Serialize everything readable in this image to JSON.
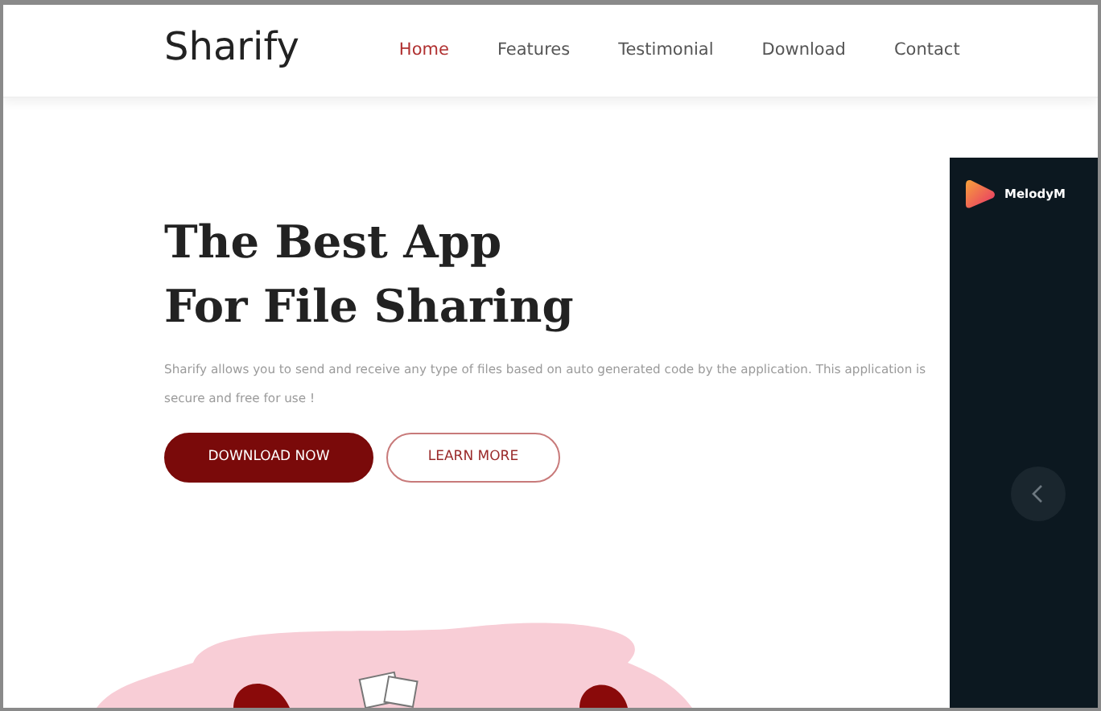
{
  "brand": "Sharify",
  "nav": [
    {
      "label": "Home",
      "selected": true
    },
    {
      "label": "Features",
      "selected": false
    },
    {
      "label": "Testimonial",
      "selected": false
    },
    {
      "label": "Download",
      "selected": false
    },
    {
      "label": "Contact",
      "selected": false
    }
  ],
  "hero": {
    "title_lines": [
      "The Best App",
      "For File Sharing"
    ],
    "description": "Sharify allows you to send and receive any type of files based on auto generated code by the application. This application is secure and free for use !",
    "buttons": [
      {
        "label": "DOWNLOAD NOW",
        "kind": "solid"
      },
      {
        "label": "LEARN MORE",
        "kind": "outline"
      }
    ]
  },
  "preview": {
    "app_name": "MelodyM"
  }
}
